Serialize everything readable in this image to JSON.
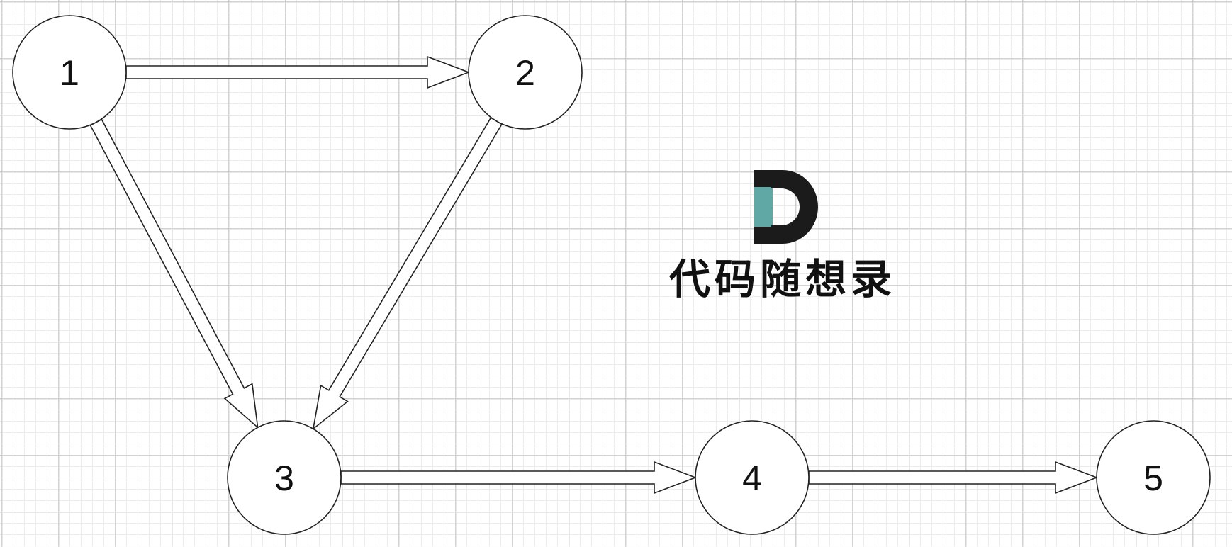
{
  "nodes": [
    {
      "id": "1",
      "label": "1"
    },
    {
      "id": "2",
      "label": "2"
    },
    {
      "id": "3",
      "label": "3"
    },
    {
      "id": "4",
      "label": "4"
    },
    {
      "id": "5",
      "label": "5"
    }
  ],
  "edges": [
    {
      "from": "1",
      "to": "2"
    },
    {
      "from": "1",
      "to": "3"
    },
    {
      "from": "2",
      "to": "3"
    },
    {
      "from": "3",
      "to": "4"
    },
    {
      "from": "4",
      "to": "5"
    }
  ],
  "watermark": {
    "text": "代码随想录",
    "colors": {
      "dark": "#1b1b1b",
      "teal": "#5fa8a6"
    }
  }
}
